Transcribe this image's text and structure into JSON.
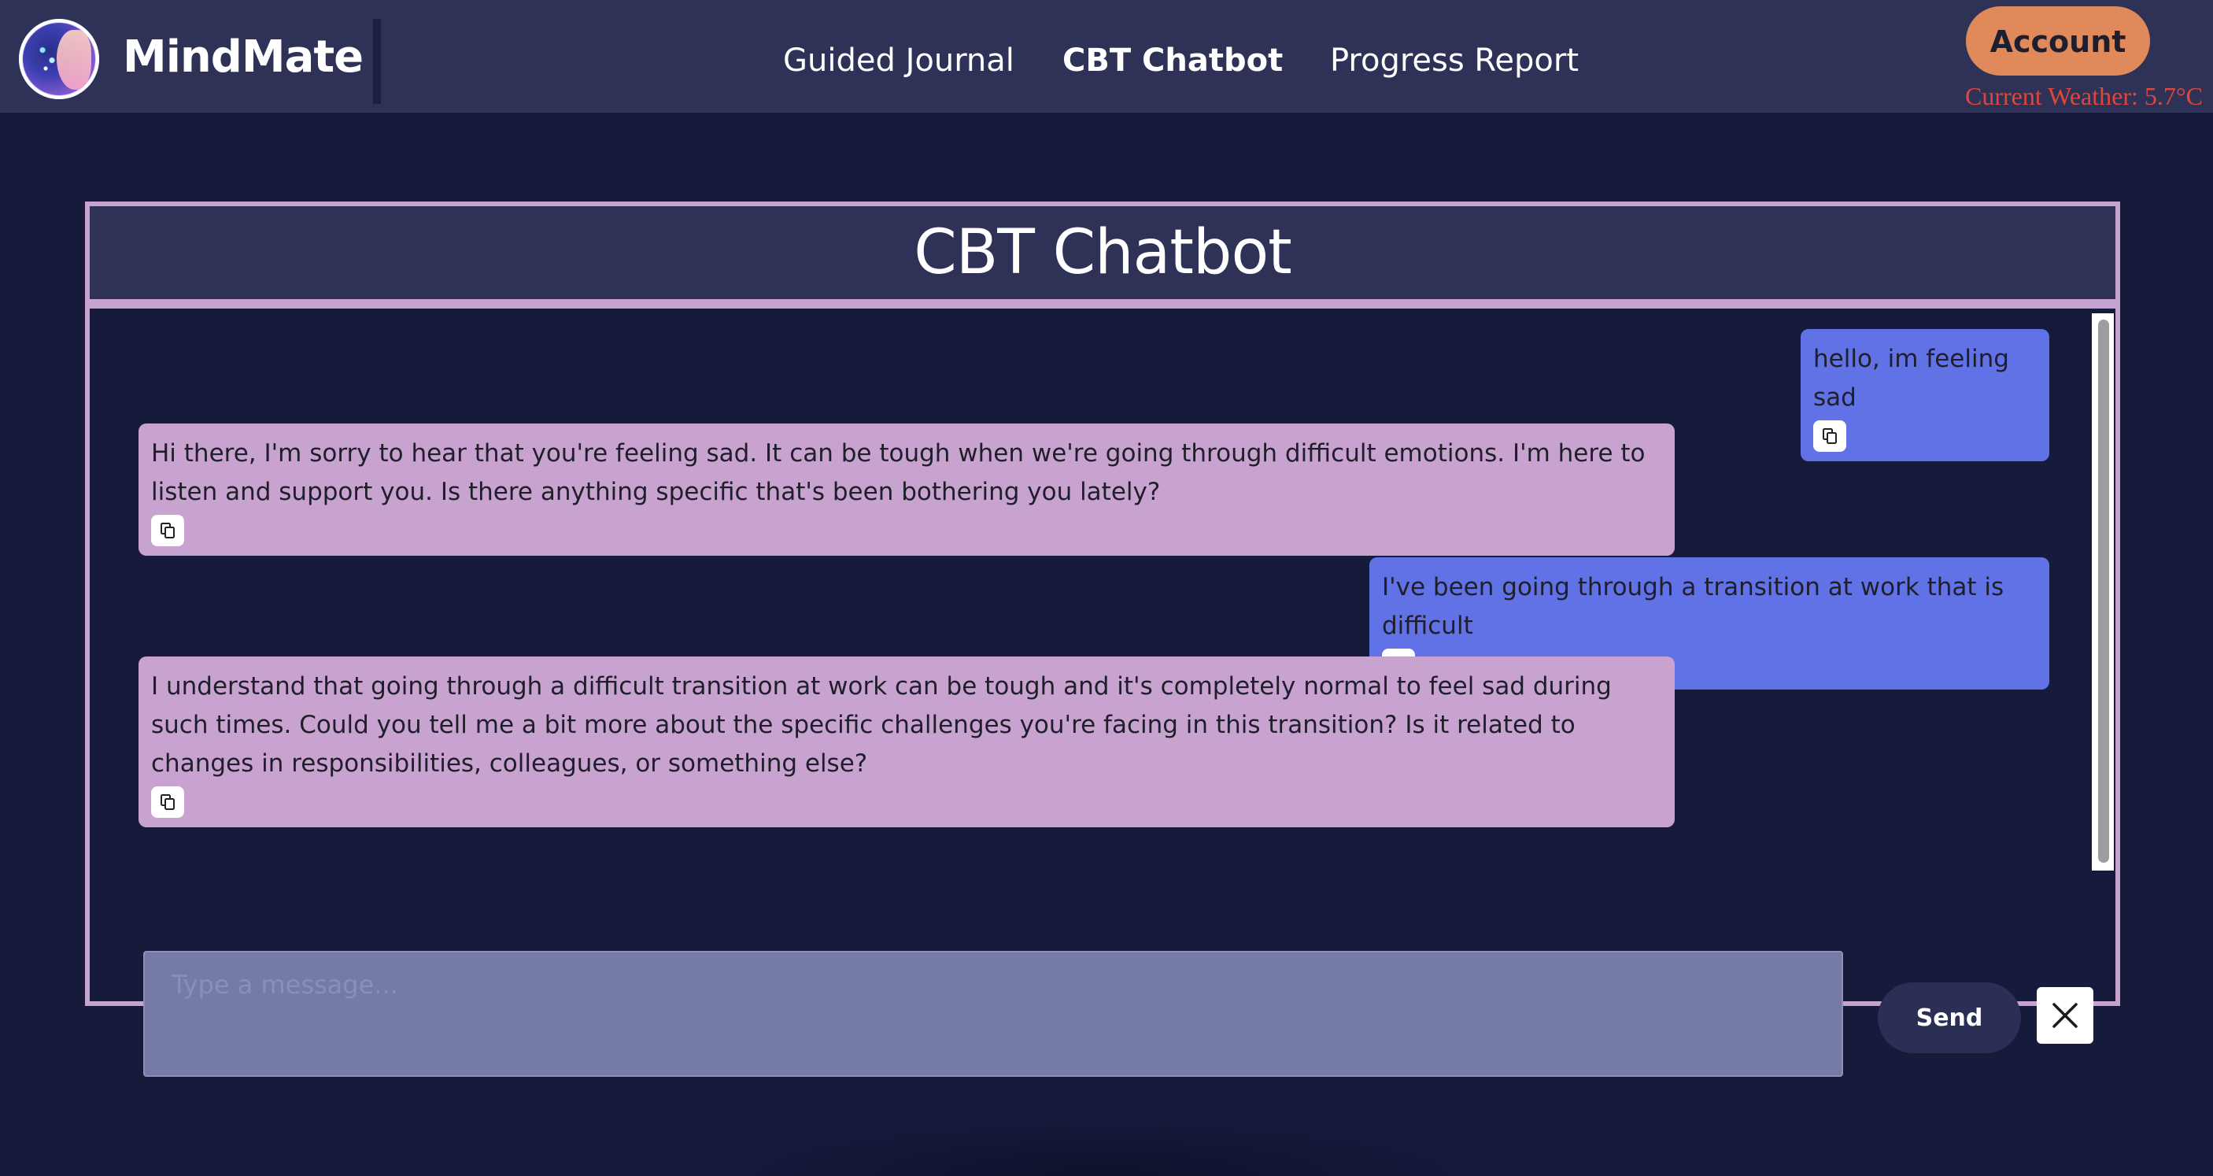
{
  "app": {
    "brand": "MindMate"
  },
  "nav": {
    "items": [
      {
        "label": "Guided Journal"
      },
      {
        "label": "CBT Chatbot"
      },
      {
        "label": "Progress Report"
      }
    ]
  },
  "header": {
    "account_label": "Account",
    "weather": "Current Weather: 5.7°C"
  },
  "chat": {
    "title": "CBT Chatbot",
    "messages": [
      {
        "role": "user",
        "text": "hello, im feeling sad"
      },
      {
        "role": "bot",
        "text": "Hi there, I'm sorry to hear that you're feeling sad. It can be tough when we're going through difficult emotions. I'm here to listen and support you. Is there anything specific that's been bothering you lately?"
      },
      {
        "role": "user",
        "text": "I've been going through a transition at work that is difficult"
      },
      {
        "role": "bot",
        "text": "I understand that going through a difficult transition at work can be tough and it's completely normal to feel sad during such times. Could you tell me a bit more about the specific challenges you're facing in this transition? Is it related to changes in responsibilities, colleagues, or something else?"
      }
    ],
    "input_placeholder": "Type a message...",
    "input_value": "",
    "send_label": "Send"
  },
  "icons": {
    "copy": "copy-icon",
    "close": "close-icon",
    "logo": "mindmate-logo-icon"
  },
  "colors": {
    "background": "#161a3b",
    "header": "#2e3256",
    "user_bubble": "#6072e6",
    "bot_bubble": "#c8a3cf",
    "panel_border": "#c6a4cf",
    "account": "#e08a5b",
    "weather": "#e0463a"
  }
}
